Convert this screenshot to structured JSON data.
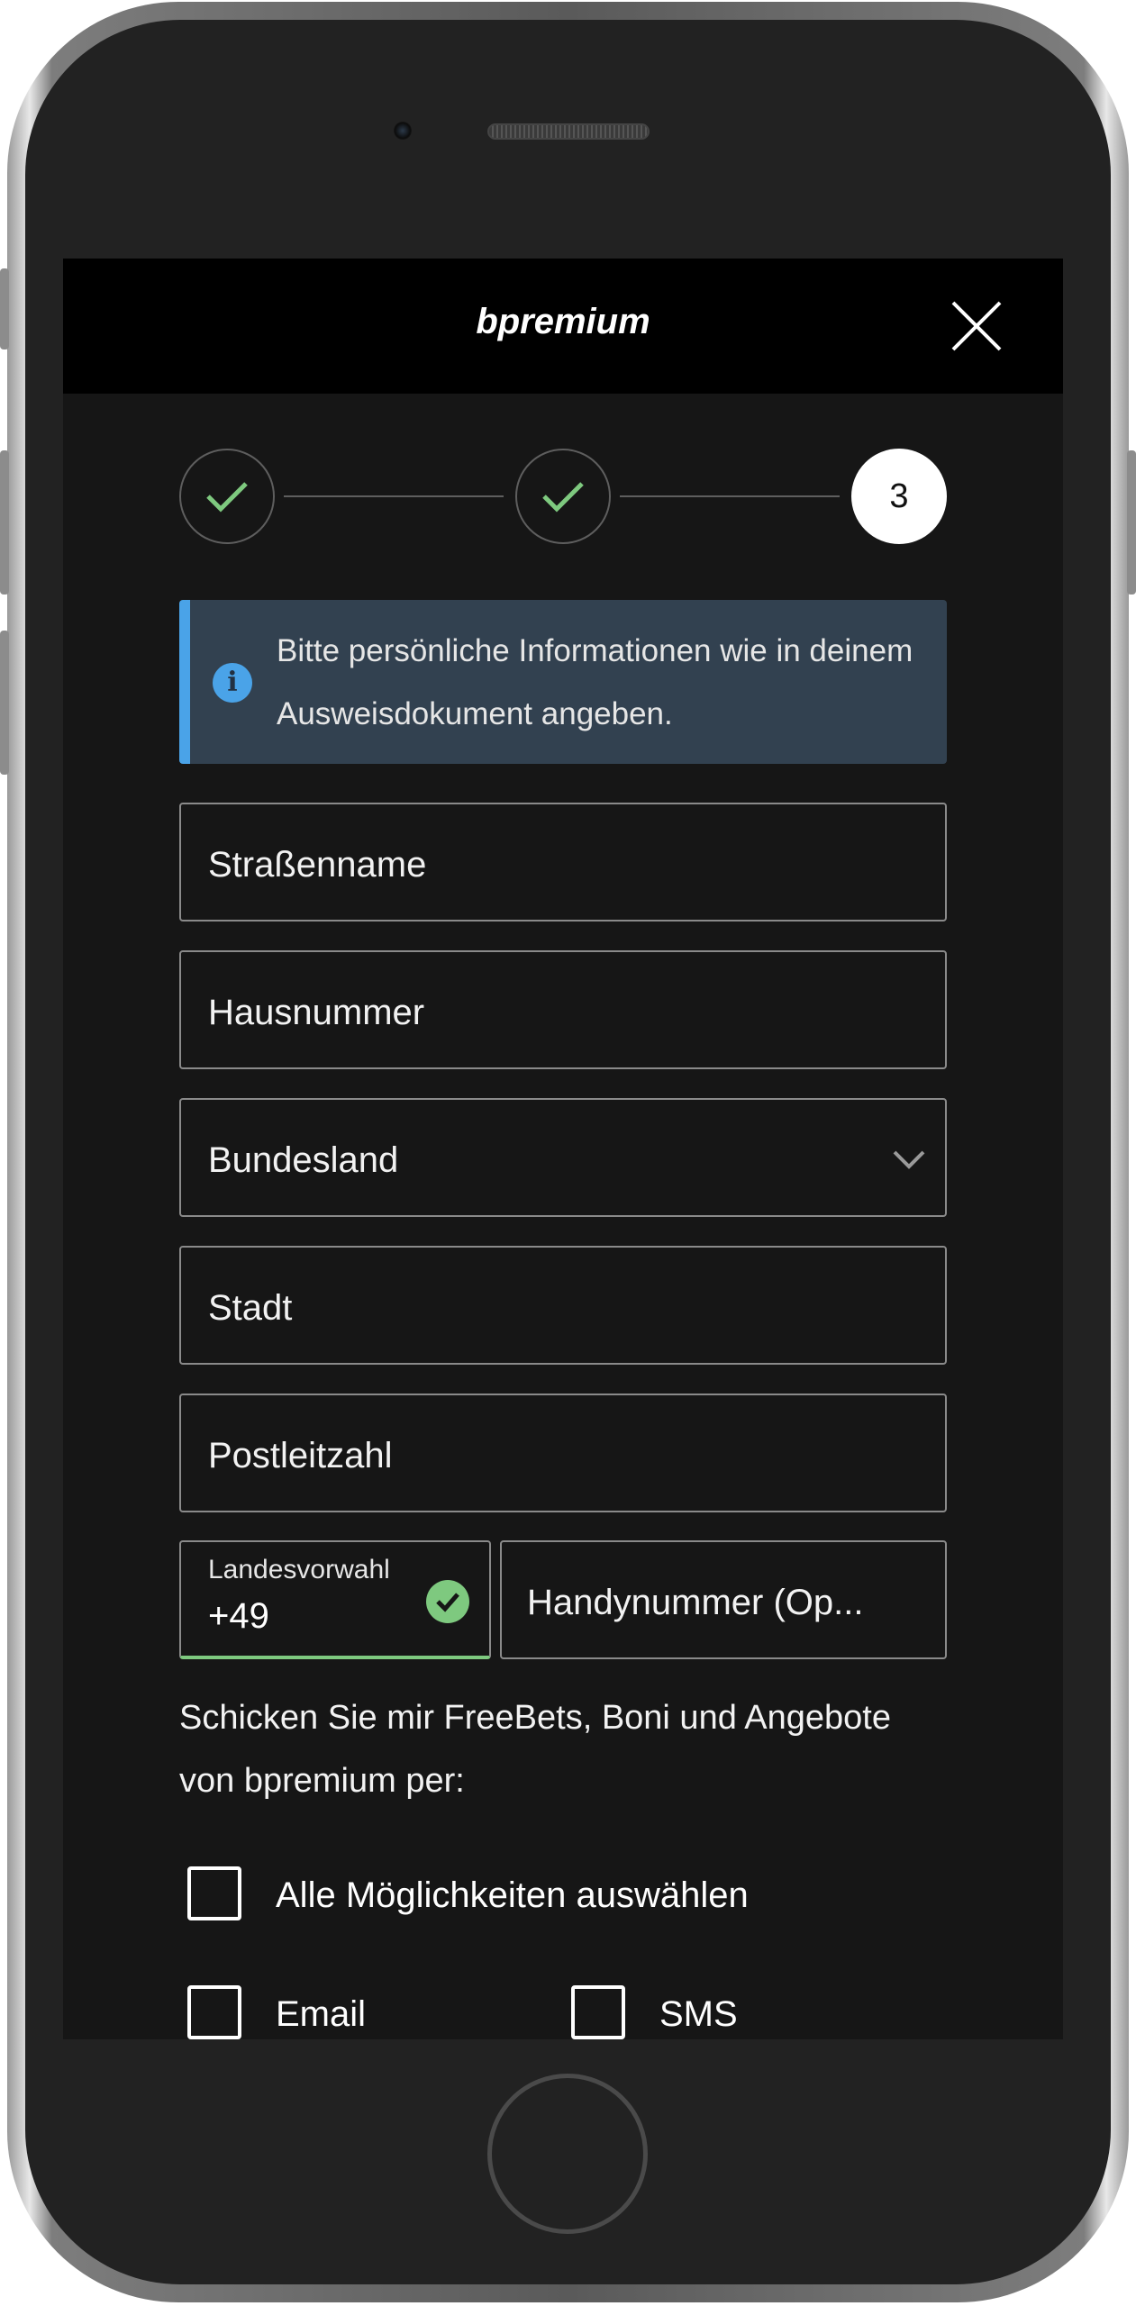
{
  "app": {
    "brand": "bpremium"
  },
  "stepper": {
    "steps": [
      {
        "state": "done"
      },
      {
        "state": "done"
      },
      {
        "state": "active",
        "label": "3"
      }
    ],
    "colors": {
      "check": "#7ec97f",
      "line": "#5e5e5e"
    }
  },
  "info": {
    "text": "Bitte persönliche Informationen wie in deinem Ausweisdokument angeben.",
    "icon": "info-icon",
    "accent": "#4aa3e8"
  },
  "form": {
    "street_placeholder": "Straßenname",
    "house_placeholder": "Hausnummer",
    "state_placeholder": "Bundesland",
    "city_placeholder": "Stadt",
    "zip_placeholder": "Postleitzahl",
    "prefix_label": "Landesvorwahl",
    "prefix_value": "+49",
    "phone_placeholder": "Handynummer (Op..."
  },
  "marketing": {
    "text": "Schicken Sie mir FreeBets, Boni und Angebote von bpremium per:",
    "select_all": "Alle Möglichkeiten auswählen",
    "email": "Email",
    "sms": "SMS"
  }
}
